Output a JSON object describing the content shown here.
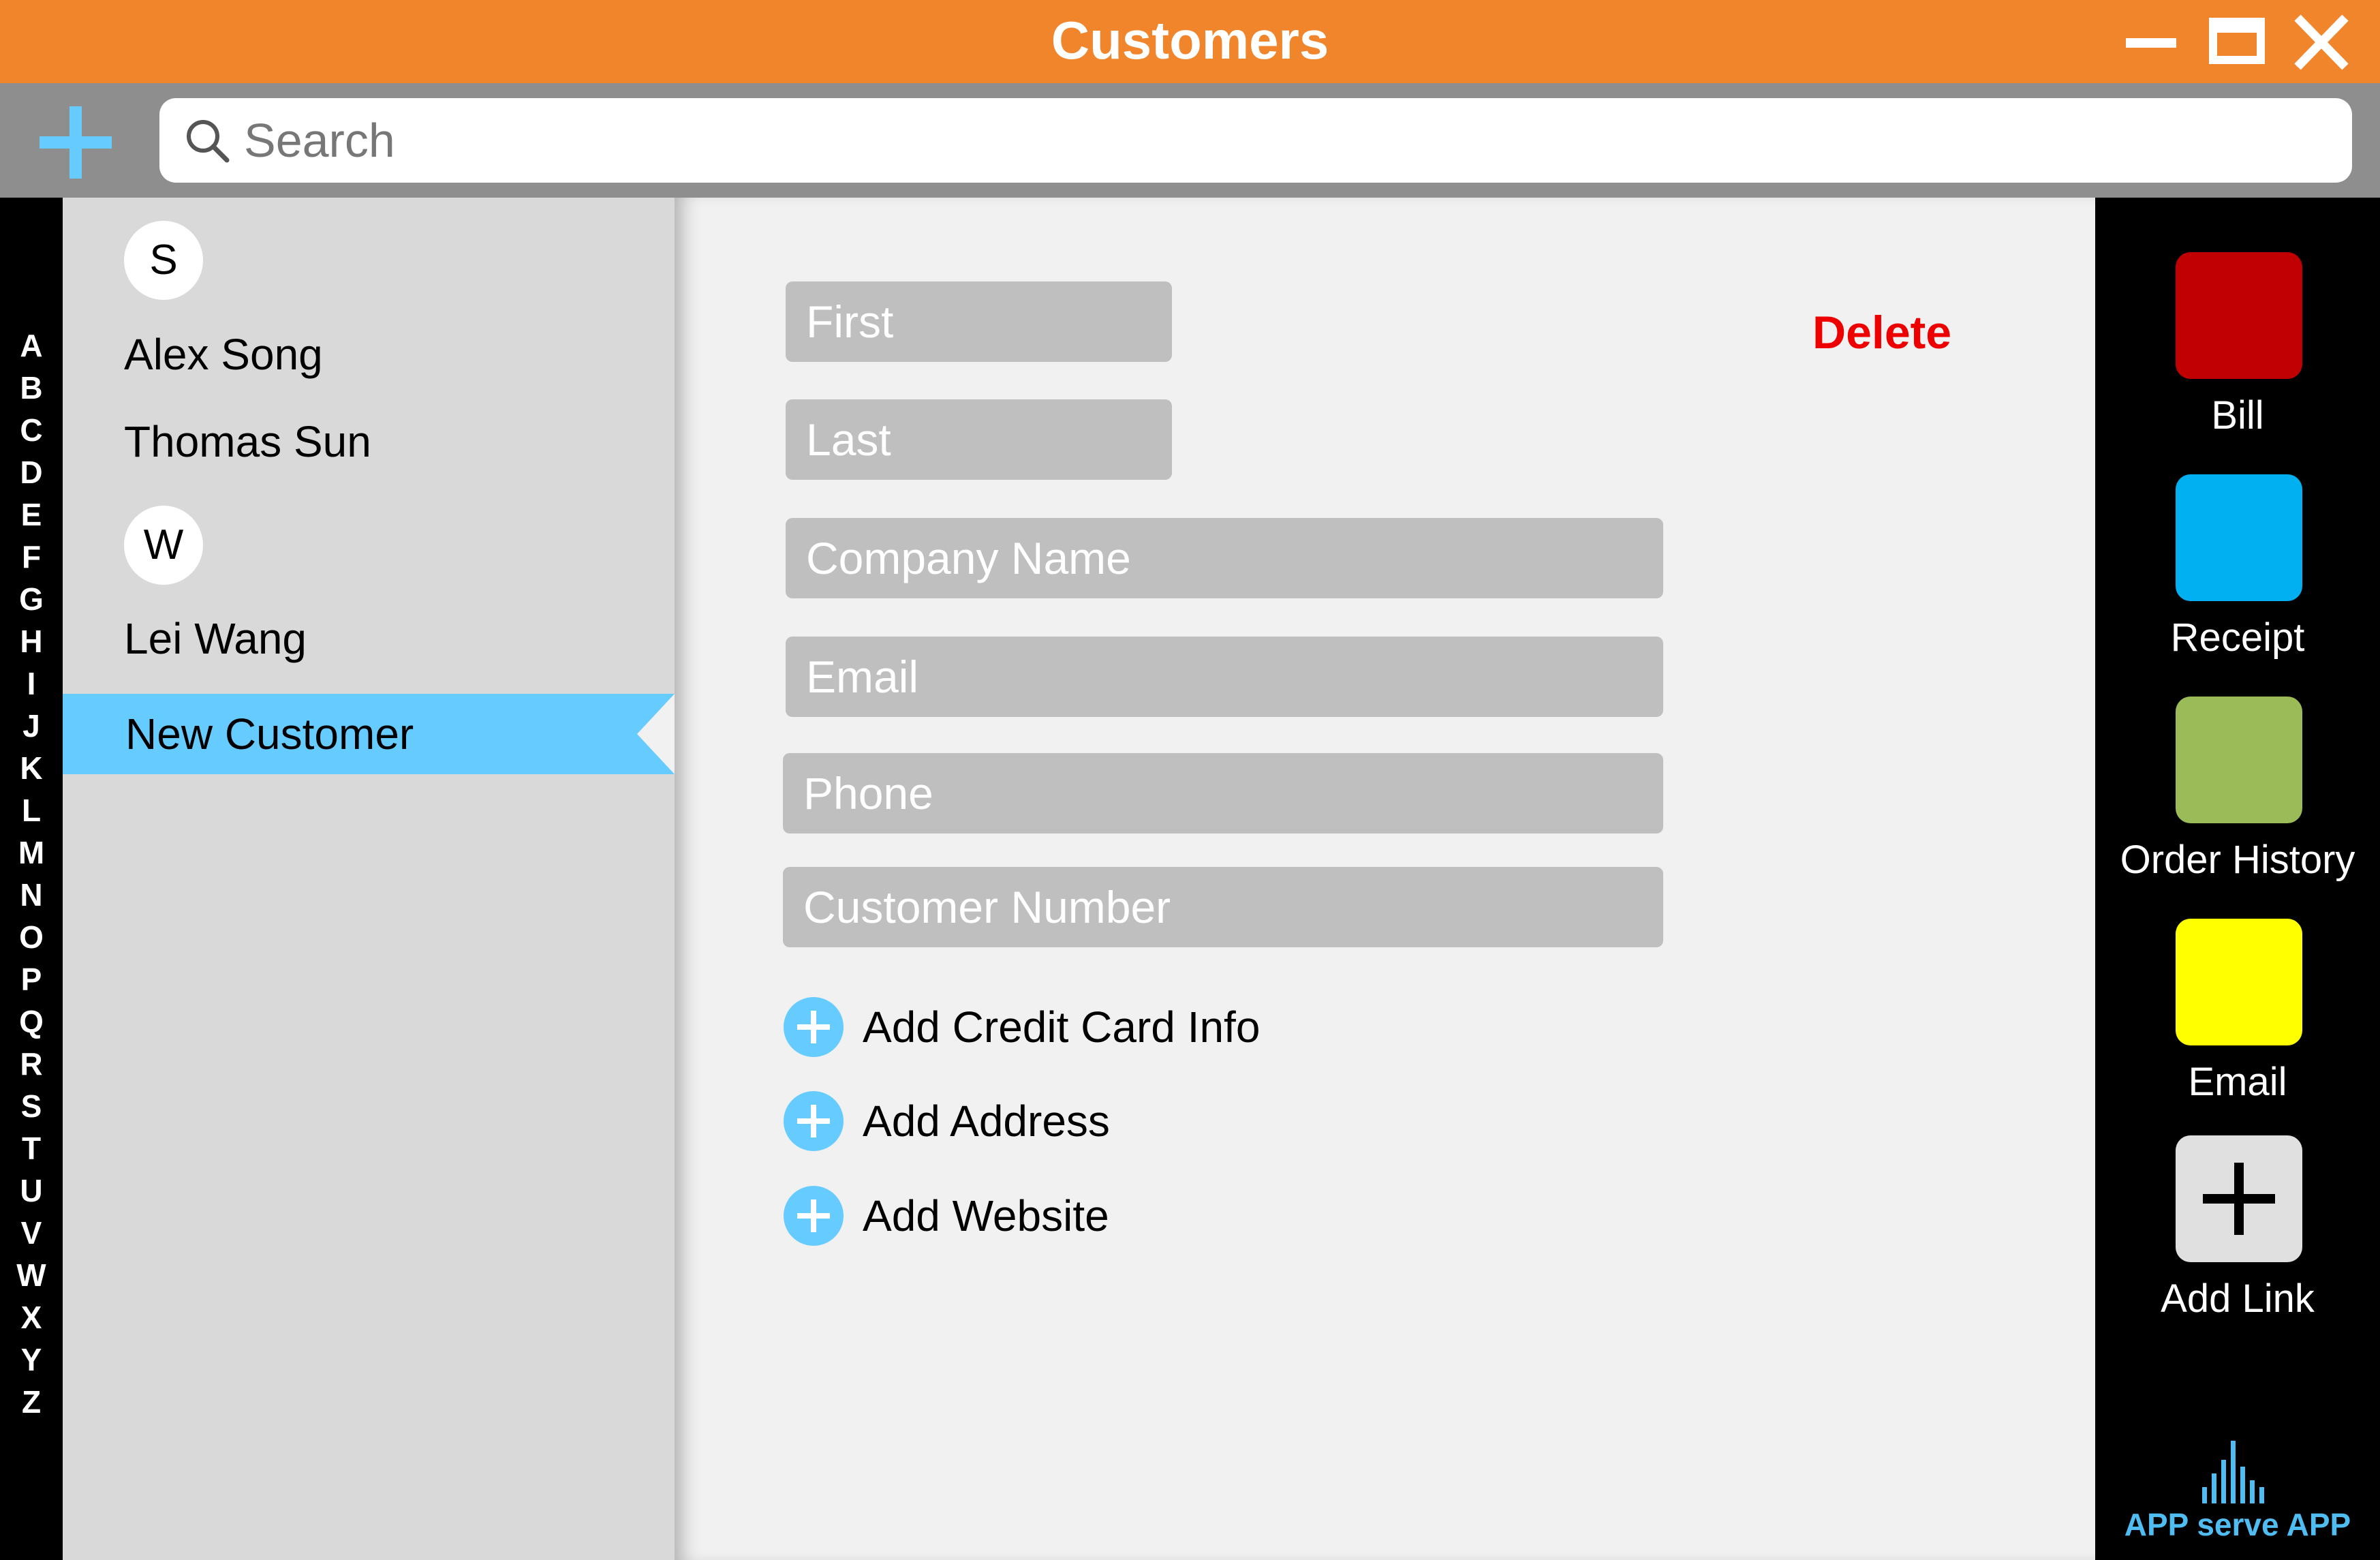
{
  "window": {
    "title": "Customers"
  },
  "toolbar": {
    "add_icon": "plus-icon",
    "search": {
      "placeholder": "Search",
      "value": "",
      "icon": "search-icon"
    }
  },
  "alphabet": [
    "A",
    "B",
    "C",
    "D",
    "E",
    "F",
    "G",
    "H",
    "I",
    "J",
    "K",
    "L",
    "M",
    "N",
    "O",
    "P",
    "Q",
    "R",
    "S",
    "T",
    "U",
    "V",
    "W",
    "X",
    "Y",
    "Z"
  ],
  "customer_list": {
    "sections": [
      {
        "letter": "S",
        "contacts": [
          "Alex Song",
          "Thomas Sun"
        ]
      },
      {
        "letter": "W",
        "contacts": [
          "Lei Wang"
        ]
      }
    ],
    "selected": "New Customer"
  },
  "form": {
    "delete_label": "Delete",
    "fields": [
      {
        "placeholder": "First",
        "value": ""
      },
      {
        "placeholder": "Last",
        "value": ""
      },
      {
        "placeholder": "Company Name",
        "value": ""
      },
      {
        "placeholder": "Email",
        "value": ""
      },
      {
        "placeholder": "Phone",
        "value": ""
      },
      {
        "placeholder": "Customer Number",
        "value": ""
      }
    ],
    "add_actions": [
      "Add Credit Card Info",
      "Add Address",
      "Add Website"
    ]
  },
  "side_actions": [
    {
      "label": "Bill",
      "color": "#c00000"
    },
    {
      "label": "Receipt",
      "color": "#00b0f0"
    },
    {
      "label": "Order History",
      "color": "#9bbb59"
    },
    {
      "label": "Email",
      "color": "#ffff00"
    },
    {
      "label": "Add Link",
      "color": "#e0e0e0",
      "icon": "plus-icon"
    }
  ],
  "brand": {
    "text": "APP serve APP",
    "icon": "bar-chart-icon"
  },
  "colors": {
    "title_bar": "#f0852c",
    "toolbar": "#8e8e8e",
    "accent": "#66ccff",
    "delete": "#ee0000"
  }
}
